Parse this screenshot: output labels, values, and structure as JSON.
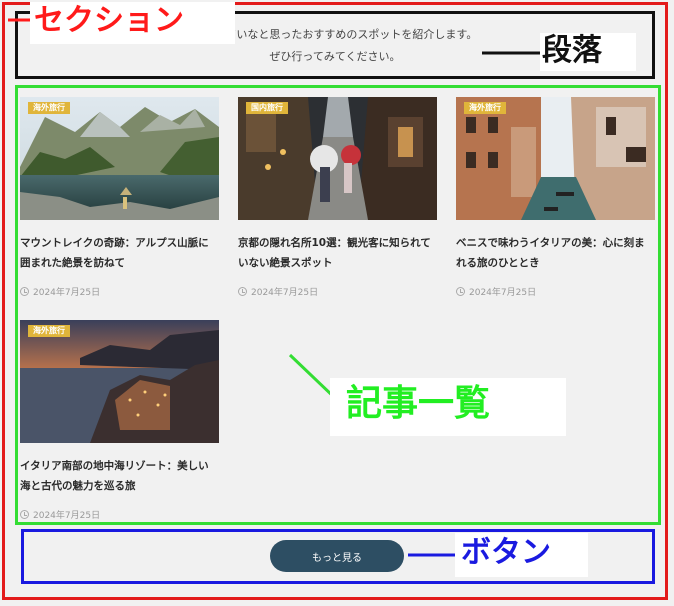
{
  "annotations": {
    "section": "セクション",
    "paragraph": "段落",
    "article_list": "記事一覧",
    "button": "ボタン"
  },
  "intro": {
    "line1": "すていていなと思ったおすすめのスポットを紹介します。",
    "line2": "ぜひ行ってみてください。"
  },
  "articles": [
    {
      "category": "海外旅行",
      "title": "マウントレイクの奇跡：アルプス山脈に囲まれた絶景を訪ねて",
      "date": "2024年7月25日"
    },
    {
      "category": "国内旅行",
      "title": "京都の隠れ名所10選：観光客に知られていない絶景スポット",
      "date": "2024年7月25日"
    },
    {
      "category": "海外旅行",
      "title": "ベニスで味わうイタリアの美：心に刻まれる旅のひととき",
      "date": "2024年7月25日"
    },
    {
      "category": "海外旅行",
      "title": "イタリア南部の地中海リゾート：美しい海と古代の魅力を巡る旅",
      "date": "2024年7月25日"
    }
  ],
  "more_button": "もっと見る",
  "colors": {
    "section_frame": "#e31b1b",
    "paragraph_frame": "#111111",
    "list_frame": "#33dd33",
    "button_frame": "#1a1ae0",
    "category_badge": "#e0b53a",
    "button_bg": "#2d4e63"
  }
}
